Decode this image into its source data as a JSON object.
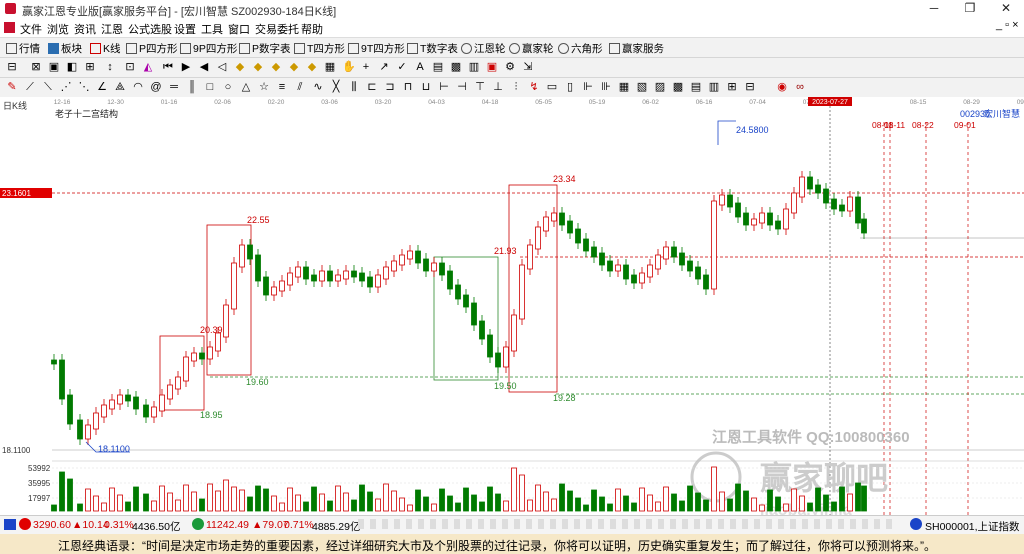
{
  "window": {
    "title": "赢家江恩专业版[赢家服务平台] - [宏川智慧  SZ002930-184日K线]",
    "min": "─",
    "max": "❐",
    "close": "✕"
  },
  "menu": [
    "文件",
    "浏览",
    "资讯",
    "江恩",
    "公式选股",
    "设置",
    "工具",
    "窗口",
    "交易委托",
    "帮助"
  ],
  "toolbar1": [
    "行情",
    "板块",
    "K线",
    "P四方形",
    "9P四方形",
    "P数字表",
    "T四方形",
    "9T四方形",
    "T数字表",
    "江恩轮",
    "赢家轮",
    "六角形",
    "赢家服务"
  ],
  "chart": {
    "period_label": "日K线",
    "indicator_name": "老子十二宫结构",
    "stock_code": "002930",
    "stock_name": "宏川智慧",
    "y_labels": [
      "23.1601",
      "18.1100"
    ],
    "vol_labels": [
      "53992",
      "35995",
      "17997"
    ],
    "date_labels": [
      "12-16",
      "12-30",
      "01-16",
      "02-06",
      "02-20",
      "03-06",
      "03-20",
      "04-03",
      "04-18",
      "05-05",
      "05-19",
      "06-02",
      "06-16",
      "07-04",
      "07-18",
      "2023-07-27",
      "08-15",
      "08-29",
      "09-12"
    ],
    "annotations": [
      "24.5800",
      "23.34",
      "22.55",
      "21.93",
      "20.39",
      "19.60",
      "19.50",
      "19.28",
      "18.95",
      "18.1100"
    ],
    "future_dates": [
      "08-11",
      "08-22",
      "09-01"
    ],
    "watermark1": "江恩工具软件  QQ:100800360",
    "watermark2": "赢家聊吧",
    "watermark3": "jiaoba.yinjia"
  },
  "statusbar": {
    "sh_index": "3290.60",
    "sh_change": "▲10.14",
    "sh_pct": "0.31%",
    "sh_amount": "4436.50亿",
    "sz_index": "11242.49",
    "sz_change": "▲79.07",
    "sz_pct": "0.71%",
    "sz_amount": "4885.29亿",
    "right_tab": "SH000001,上证指数"
  },
  "quote": "江恩经典语录：“时间是决定市场走势的重要因素，经过详细研究大市及个别股票的过往记录，你将可以证明，历史确实重复发生；而了解过往，你将可以预测将来。”。",
  "colors": {
    "up": "#d00000",
    "down": "#007a00",
    "bg": "#ffffff"
  }
}
